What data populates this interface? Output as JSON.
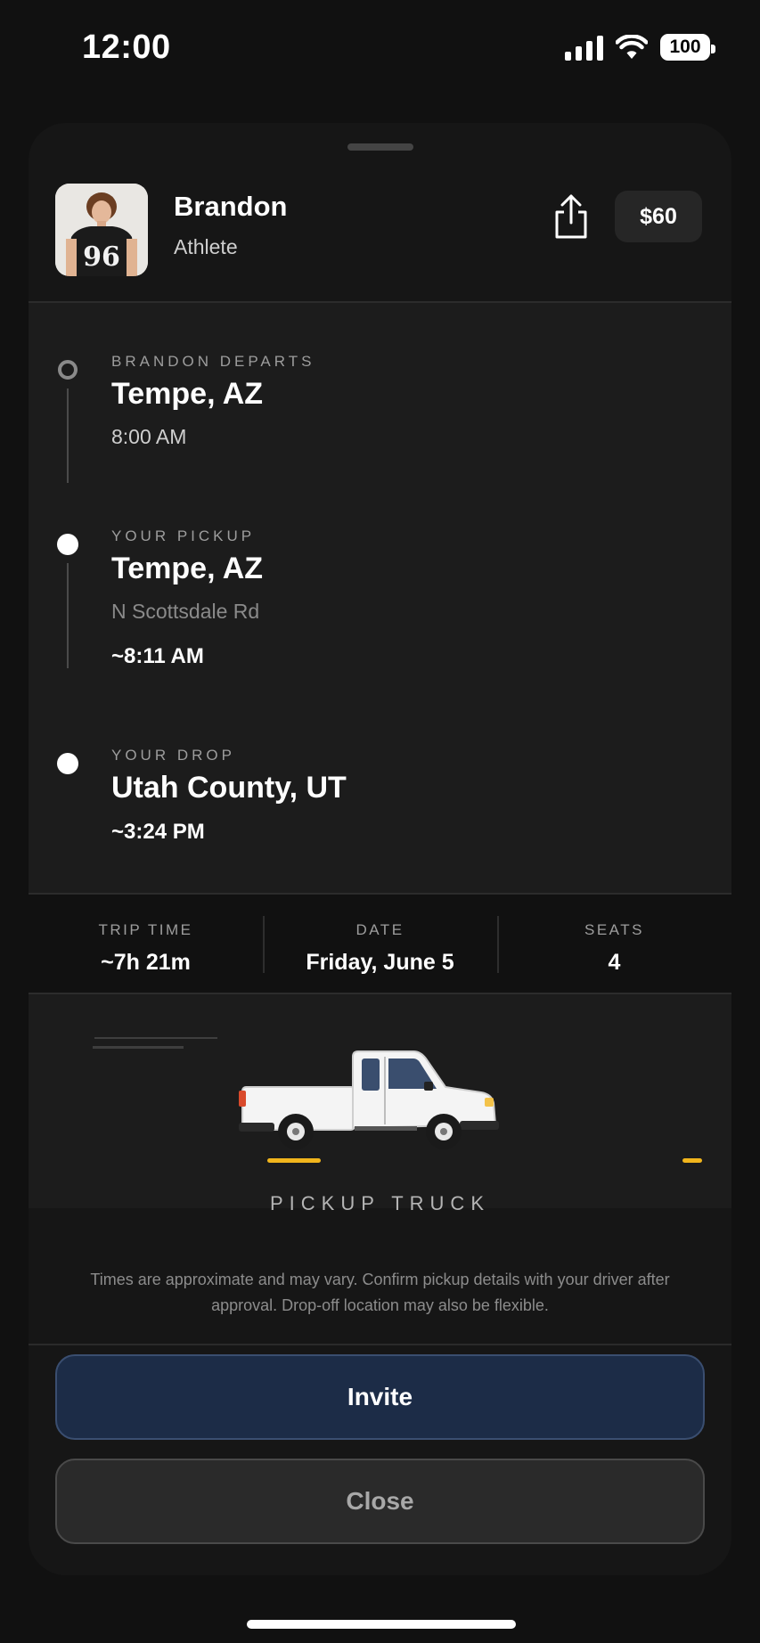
{
  "status_bar": {
    "time": "12:00",
    "battery": "100",
    "icons": [
      "cellular-signal-icon",
      "wifi-icon",
      "battery-icon"
    ]
  },
  "driver": {
    "name": "Brandon",
    "role": "Athlete",
    "price": "$60",
    "avatar_icon": "driver-avatar",
    "share_icon": "share-icon"
  },
  "route": {
    "stops": [
      {
        "label": "BRANDON DEPARTS",
        "city": "Tempe, AZ",
        "time": "8:00 AM"
      },
      {
        "label": "YOUR PICKUP",
        "city": "Tempe, AZ",
        "street": "N Scottsdale Rd",
        "time": "~8:11 AM"
      },
      {
        "label": "YOUR DROP",
        "city": "Utah County, UT",
        "time": "~3:24 PM"
      }
    ]
  },
  "trip_stats": [
    {
      "label": "TRIP TIME",
      "value": "~7h 21m"
    },
    {
      "label": "DATE",
      "value": "Friday, June 5"
    },
    {
      "label": "SEATS",
      "value": "4"
    }
  ],
  "vehicle": {
    "type": "PICKUP TRUCK",
    "icon": "pickup-truck-illustration",
    "accent_color": "#f1b51c"
  },
  "disclaimer": "Times are approximate and may vary. Confirm pickup details with your driver after approval. Drop-off location may also be flexible.",
  "actions": {
    "invite": "Invite",
    "close": "Close",
    "invite_color": "#1c2c47"
  }
}
